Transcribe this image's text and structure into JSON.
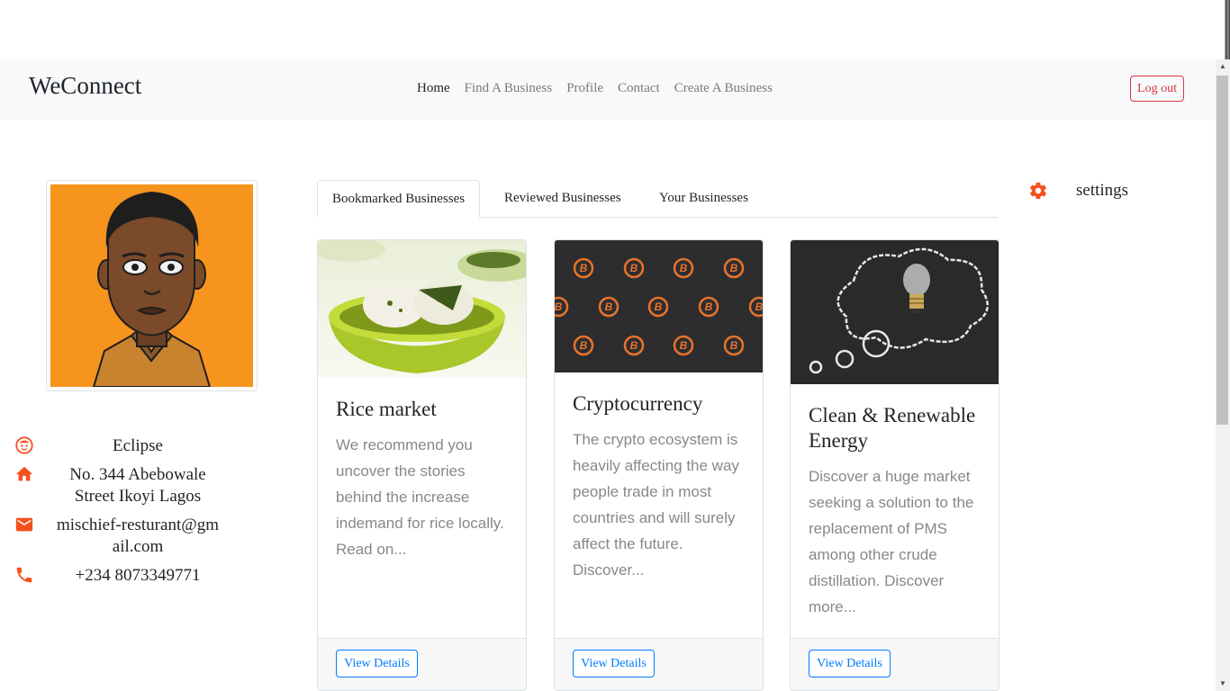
{
  "navbar": {
    "brand": "WeConnect",
    "links": [
      "Home",
      "Find A Business",
      "Profile",
      "Contact",
      "Create A Business"
    ],
    "logout_label": "Log out"
  },
  "profile": {
    "name": "Eclipse",
    "address": "No. 344 Abebowale Street Ikoyi Lagos",
    "email": "mischief-resturant@gmail.com",
    "phone": "+234 8073349771",
    "icons": [
      "face-icon",
      "home-icon",
      "email-icon",
      "phone-icon"
    ]
  },
  "tabs": [
    "Bookmarked Businesses",
    "Reviewed Businesses",
    "Your Businesses"
  ],
  "settings": {
    "label": "settings",
    "icon": "gear-icon"
  },
  "cards": [
    {
      "title": "Rice market",
      "text": "We recommend you uncover the stories behind the increase indemand for rice locally. Read on...",
      "button": "View Details"
    },
    {
      "title": "Cryptocurrency",
      "text": "The crypto ecosystem is heavily affecting the way people trade in most countries and will surely affect the future. Discover...",
      "button": "View Details"
    },
    {
      "title": "Clean & Renewable Energy",
      "text": "Discover a huge market seeking a solution to the replacement of PMS among other crude distillation. Discover more...",
      "button": "View Details"
    }
  ],
  "colors": {
    "accent": "#f4511e",
    "primary": "#007bff",
    "danger": "#dc3545",
    "avatar_bg": "#f7941d"
  }
}
